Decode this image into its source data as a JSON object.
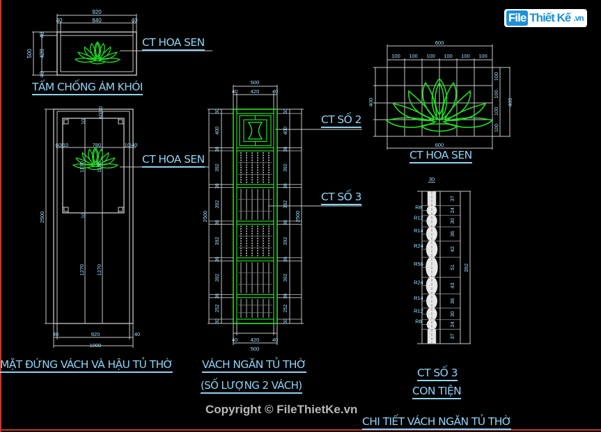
{
  "watermark": {
    "logo_part1": "File",
    "logo_part2": "Thiết Kế",
    "logo_tld": ".vn",
    "copyright": "Copyright © FileThietKe.vn"
  },
  "colors": {
    "background": "#000000",
    "text": "#8fd3f4",
    "dimension_text": "#9fe0ff",
    "lines": "#c8c8c8",
    "lotus": "#22dd22",
    "partition": "#22dd22",
    "frame": "#c0392b",
    "logo": "#1e90d6"
  },
  "labels": {
    "smoke_panel": "TẤM CHỐNG ÁM KHÓI",
    "ct_hoa_sen_top": "CT HOA SEN",
    "ct_hoa_sen_mid": "CT HOA SEN",
    "ct_hoa_sen_detail": "CT HOA SEN",
    "ct_so_2": "CT SỐ 2",
    "ct_so_3_callout": "CT SỐ 3",
    "elevation": "MẶT ĐỨNG VÁCH VÀ HẬU TỦ THỜ",
    "partition_title": "VÁCH NGĂN TỦ THỜ",
    "partition_qty": "(SỐ LƯỢNG 2 VÁCH)",
    "ct_so_3_title": "CT SỐ 3",
    "con_tien": "CON TIỆN",
    "sheet_title": "CHI TIẾT VÁCH NGĂN TỦ THỜ"
  },
  "dimensions": {
    "smoke_panel": {
      "total_w": "920",
      "side_l": "40",
      "inner_w": "840",
      "side_r": "40",
      "total_h": "500",
      "top": "40",
      "inner_h": "420",
      "bottom": "40"
    },
    "elevation": {
      "height": "2500",
      "top_dim": "60|10",
      "left_dim": "60|10",
      "lotus_w": "780",
      "right_dim": "10|40",
      "lotus_h1": "1130",
      "lotus_h2": "1130",
      "small_top": "10",
      "small_bottom": "10",
      "lower_h1": "1270",
      "lower_h2": "1270",
      "bot_l": "40",
      "bot_mid": "920",
      "bot_r": "40",
      "total_w": "1000"
    },
    "partition": {
      "top_total": "500",
      "top_l": "40",
      "top_mid": "420",
      "top_r": "40",
      "height": "2500",
      "segments": [
        "50",
        "400",
        "36",
        "392",
        "36",
        "392",
        "36",
        "392",
        "36",
        "392",
        "36",
        "252",
        "50"
      ],
      "bot_l": "40",
      "bot_mid": "420",
      "bot_r": "40",
      "bot_total": "500"
    },
    "lotus_detail": {
      "total_w": "600",
      "cols": [
        "100",
        "100",
        "100",
        "100",
        "100",
        "100"
      ],
      "total_h_l": "400",
      "rows": [
        "100",
        "100",
        "100",
        "100"
      ],
      "total_h_r": "400",
      "bottom_w": "600"
    },
    "baluster": {
      "width": "30",
      "radii": [
        "R8",
        "R12",
        "R14",
        "R24",
        "R56",
        "R24",
        "R14",
        "R12",
        "R8"
      ],
      "segments": [
        "37",
        "24",
        "30",
        "36",
        "42",
        "51",
        "43",
        "36",
        "30",
        "24",
        "37"
      ],
      "total": "392"
    }
  }
}
